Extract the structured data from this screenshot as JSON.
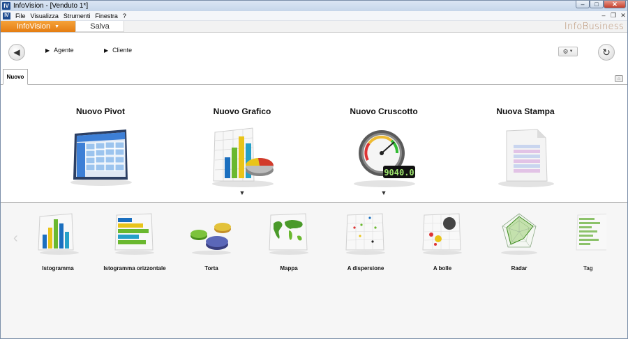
{
  "window": {
    "title": "InfoVision  - [Venduto 1*]",
    "app_icon": "IV"
  },
  "menubar": {
    "items": [
      "File",
      "Visualizza",
      "Strumenti",
      "Finestra",
      "?"
    ]
  },
  "ribbon": {
    "app_menu_label": "InfoVision",
    "save_label": "Salva",
    "brand": "InfoBusiness"
  },
  "toolbar": {
    "breadcrumbs": [
      "Agente",
      "Cliente"
    ]
  },
  "doc_tabs": {
    "active": "Nuovo"
  },
  "create": {
    "items": [
      {
        "label": "Nuovo Pivot",
        "icon": "pivot-table-icon",
        "has_dropdown": false
      },
      {
        "label": "Nuovo Grafico",
        "icon": "chart-icon",
        "has_dropdown": true
      },
      {
        "label": "Nuovo Cruscotto",
        "icon": "gauge-icon",
        "has_dropdown": true,
        "gauge_readout": "9040.0"
      },
      {
        "label": "Nuova Stampa",
        "icon": "report-document-icon",
        "has_dropdown": false
      }
    ]
  },
  "chart_types": [
    {
      "label": "Istogramma",
      "icon": "bar-chart-icon"
    },
    {
      "label": "Istogramma orizzontale",
      "icon": "horizontal-bar-chart-icon"
    },
    {
      "label": "Torta",
      "icon": "pie-chart-icon"
    },
    {
      "label": "Mappa",
      "icon": "world-map-icon"
    },
    {
      "label": "A dispersione",
      "icon": "scatter-chart-icon"
    },
    {
      "label": "A bolle",
      "icon": "bubble-chart-icon"
    },
    {
      "label": "Radar",
      "icon": "radar-chart-icon"
    },
    {
      "label": "Tag",
      "icon": "tag-cloud-icon"
    }
  ]
}
